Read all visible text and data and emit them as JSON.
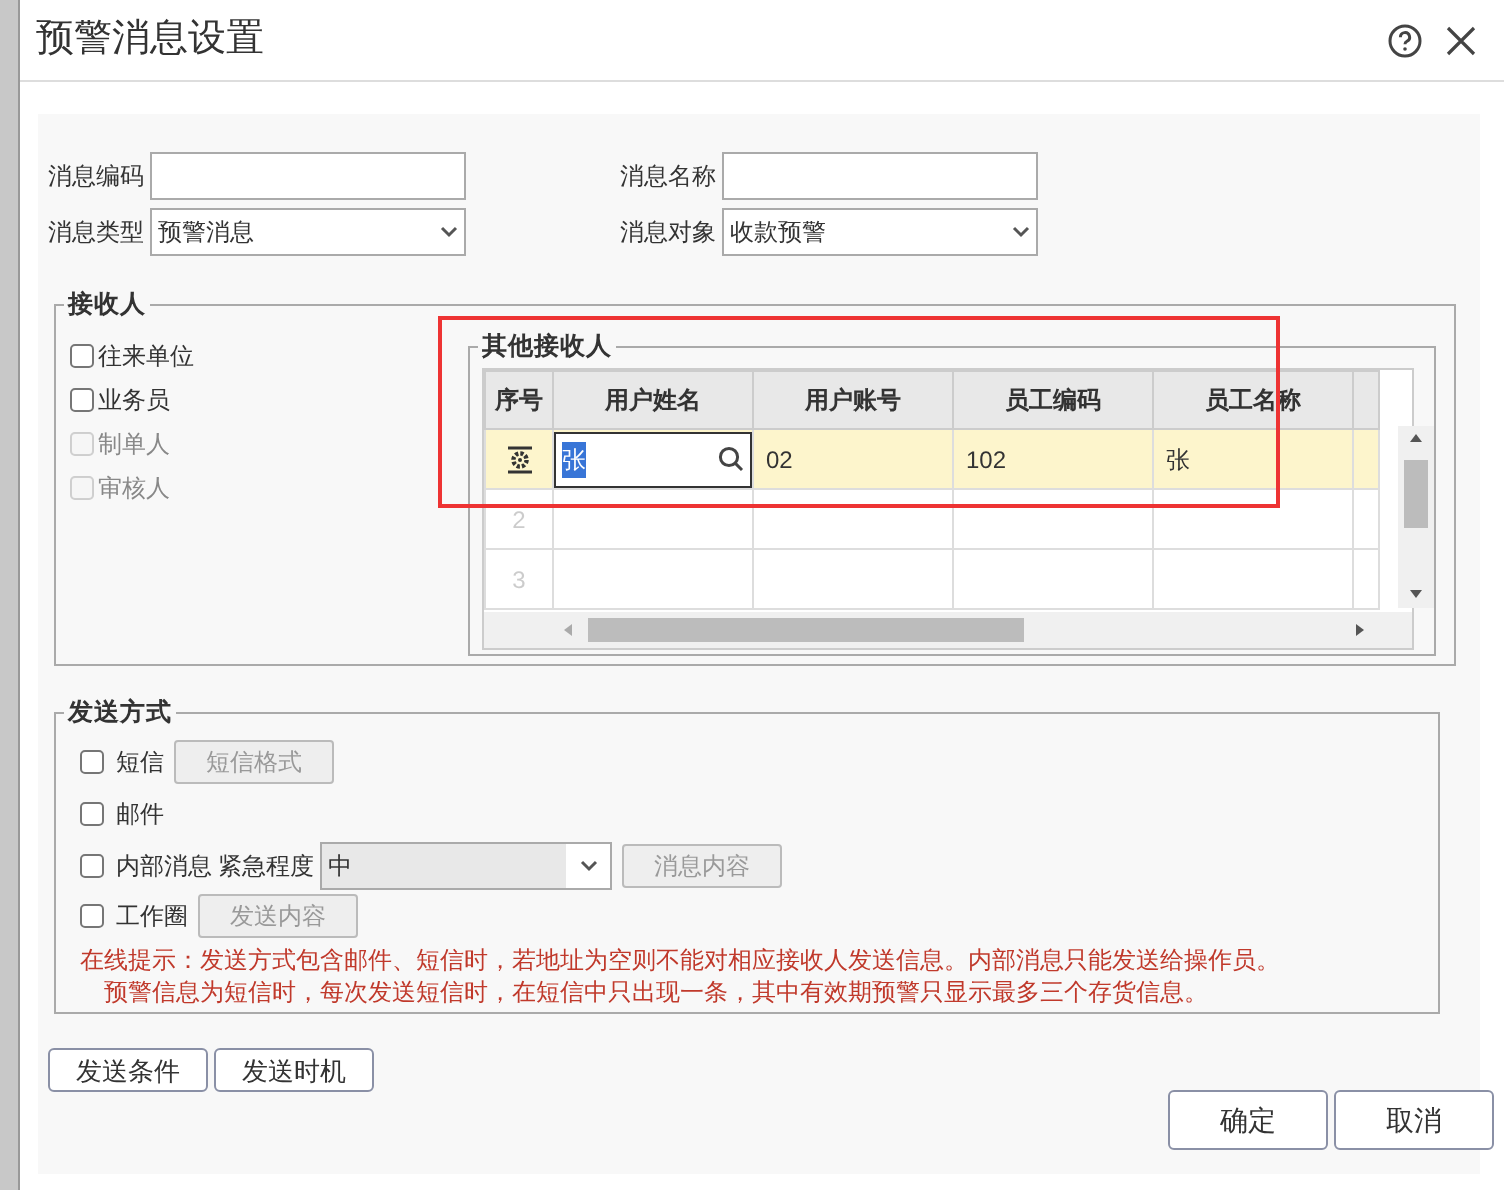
{
  "dialog": {
    "title": "预警消息设置"
  },
  "fields": [
    {
      "label": "消息编码",
      "kind": "text"
    },
    {
      "label": "消息名称",
      "kind": "text"
    },
    {
      "label": "消息类型",
      "kind": "select",
      "value": "预警消息"
    },
    {
      "label": "消息对象",
      "kind": "select",
      "value": "收款预警"
    }
  ],
  "receivers": {
    "title": "接收人",
    "options": [
      {
        "label": "往来单位",
        "checked": false,
        "disabled": false
      },
      {
        "label": "业务员",
        "checked": false,
        "disabled": false
      },
      {
        "label": "制单人",
        "checked": false,
        "disabled": true
      },
      {
        "label": "审核人",
        "checked": false,
        "disabled": true
      }
    ],
    "other": {
      "title": "其他接收人",
      "columns": [
        "序号",
        "用户姓名",
        "用户账号",
        "员工编码",
        "员工名称"
      ],
      "rows": [
        {
          "selected": true,
          "editing": true,
          "cells": [
            "张",
            "02",
            "102",
            "张"
          ]
        },
        {
          "index": "2",
          "selected": false
        },
        {
          "index": "3",
          "selected": false
        }
      ]
    }
  },
  "send": {
    "title": "发送方式",
    "methods": [
      {
        "label": "短信",
        "checked": false,
        "button": {
          "label": "短信格式",
          "disabled": true
        }
      },
      {
        "label": "邮件",
        "checked": false
      },
      {
        "label": "内部消息",
        "checked": false,
        "urgency": {
          "label": "紧急程度",
          "value": "中",
          "disabled": true
        },
        "button": {
          "label": "消息内容",
          "disabled": true
        }
      },
      {
        "label": "工作圈",
        "checked": false,
        "button": {
          "label": "发送内容",
          "disabled": true
        }
      }
    ],
    "notice": [
      "在线提示：发送方式包含邮件、短信时，若地址为空则不能对相应接收人发送信息。内部消息只能发送给操作员。",
      "预警信息为短信时，每次发送短信时，在短信中只出现一条，其中有效期预警只显示最多三个存货信息。"
    ]
  },
  "buttons_left": [
    "发送条件",
    "发送时机"
  ],
  "buttons_right": [
    "确定",
    "取消"
  ],
  "annotations": [
    {
      "kind": "rectangle"
    }
  ]
}
